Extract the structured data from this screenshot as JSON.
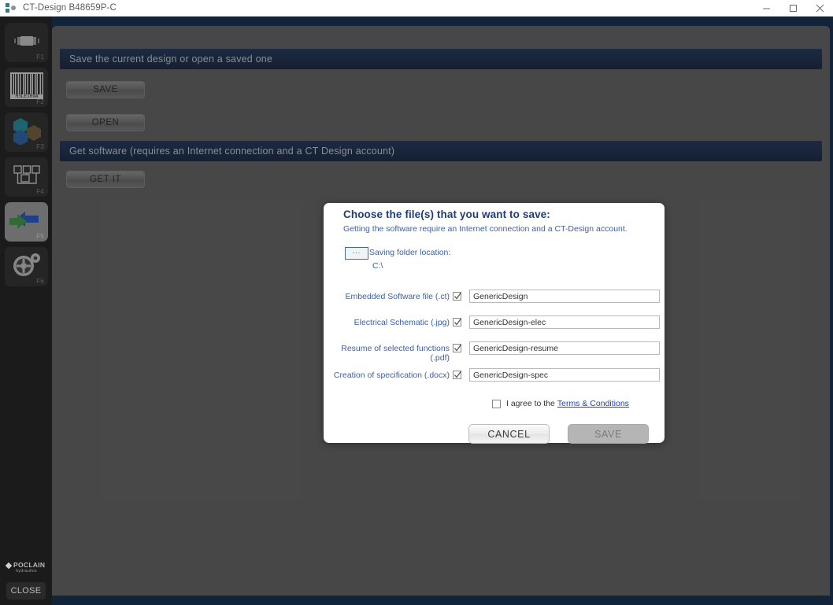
{
  "window": {
    "title": "CT-Design B48659P-C",
    "app_icon": "app-logo-icon",
    "controls": {
      "minimize": "minimize-icon",
      "maximize": "maximize-icon",
      "close": "close-icon"
    }
  },
  "sidebar": {
    "items": [
      {
        "icon": "cylinder-icon",
        "fkey": "F1",
        "selected": false
      },
      {
        "icon": "barcode-icon",
        "fkey": "F2",
        "selected": false
      },
      {
        "icon": "hexagons-icon",
        "fkey": "F3",
        "selected": false
      },
      {
        "icon": "schematic-icon",
        "fkey": "F4",
        "selected": false
      },
      {
        "icon": "save-open-arrows-icon",
        "fkey": "F5",
        "selected": true
      },
      {
        "icon": "settings-gear-icon",
        "fkey": "F6",
        "selected": false
      }
    ],
    "brand": {
      "name": "POCLAIN",
      "sub": "hydraulics"
    },
    "close_label": "CLOSE"
  },
  "main": {
    "sections": [
      {
        "title": "Save the current design or open a saved one",
        "buttons": [
          "SAVE",
          "OPEN"
        ]
      },
      {
        "title": "Get software (requires an Internet connection and a CT Design account)",
        "buttons": [
          "GET IT"
        ]
      }
    ]
  },
  "dialog": {
    "title": "Choose the file(s) that you want to save:",
    "subtitle": "Getting the software require an Internet connection and a CT-Design account.",
    "browse_label": "...",
    "folder_label": "Saving folder location:",
    "folder_path": "C:\\",
    "files": [
      {
        "label": "Embedded Software file (.ct)",
        "checked": true,
        "value": "GenericDesign"
      },
      {
        "label": "Electrical Schematic (.jpg)",
        "checked": true,
        "value": "GenericDesign-elec"
      },
      {
        "label": "Resume of selected functions (.pdf)",
        "checked": true,
        "value": "GenericDesign-resume"
      },
      {
        "label": "Creation of specification (.docx)",
        "checked": true,
        "value": "GenericDesign-spec"
      }
    ],
    "agree": {
      "checked": false,
      "text": "I agree to the",
      "link": "Terms & Conditions"
    },
    "buttons": {
      "cancel": "CANCEL",
      "save": "SAVE",
      "save_enabled": false
    }
  },
  "colors": {
    "titlebar_bg": "#ffffff",
    "app_bg": "#12243a",
    "sidebar_bg": "#1b1b1b",
    "panel_bg": "#5e5e5e",
    "band_navy": "#1b2c4b",
    "dialog_bg": "#ffffff",
    "dialog_title_blue": "#1f3e78",
    "label_blue": "#3a5fa8",
    "link_blue": "#1a43c8",
    "arrow_green": "#2f6b35",
    "arrow_blue": "#1f3f86"
  }
}
